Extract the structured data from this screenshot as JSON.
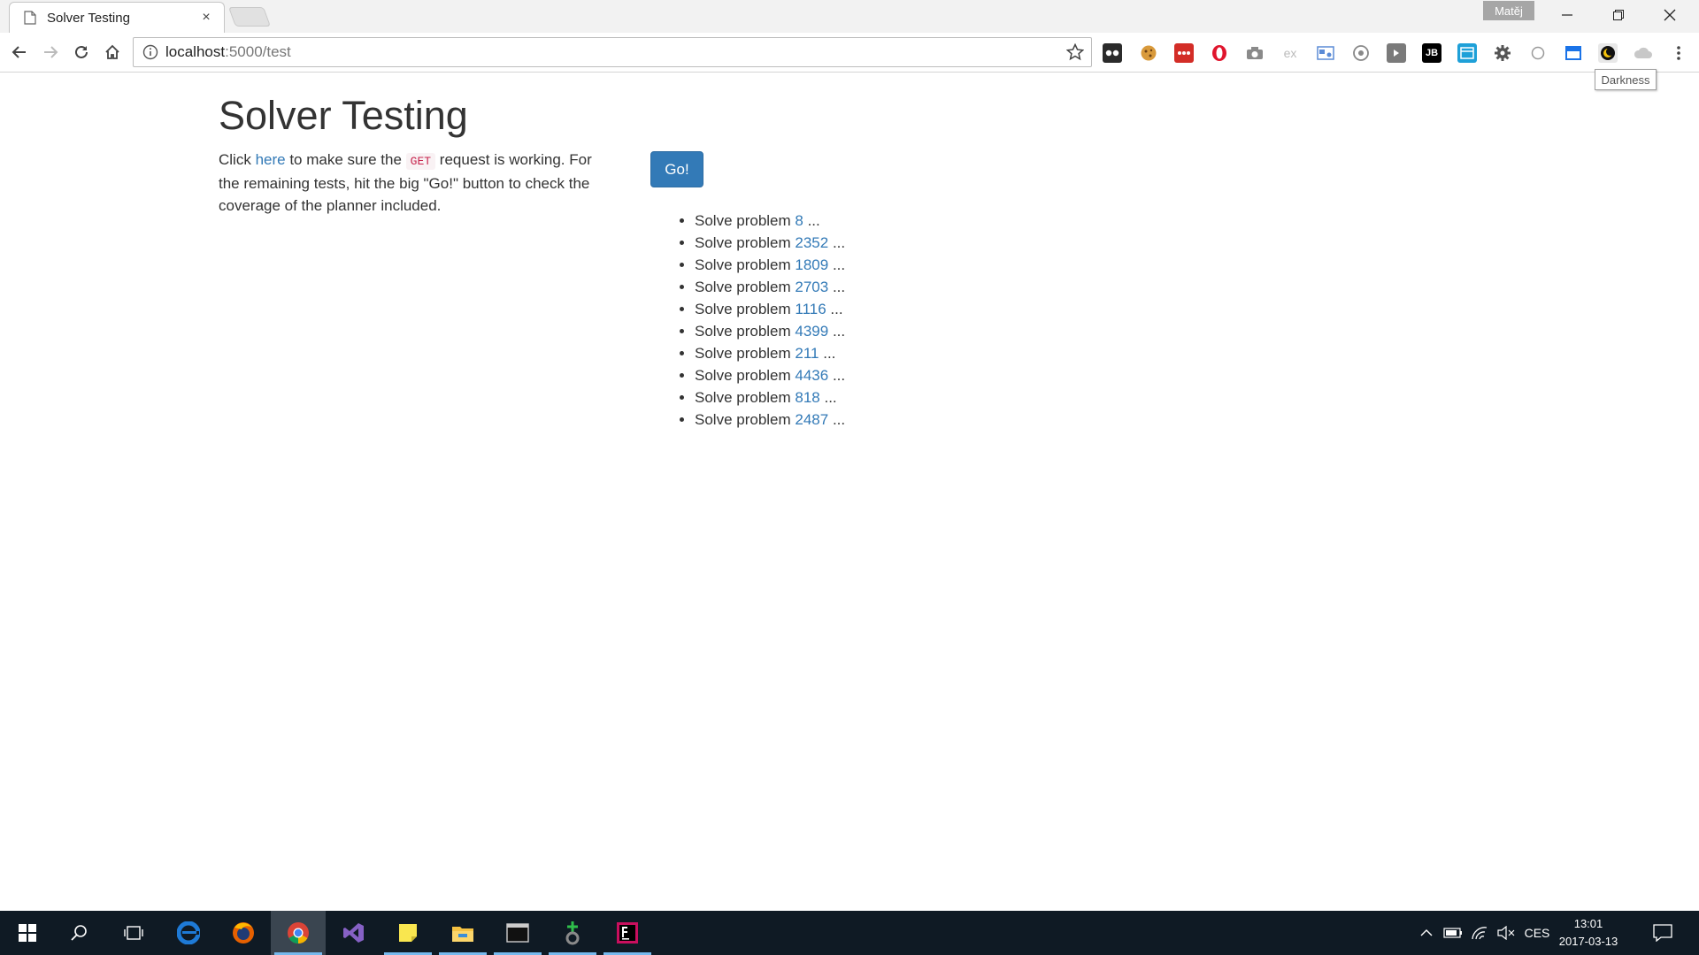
{
  "browser": {
    "tab_title": "Solver Testing",
    "tab_close": "×",
    "profile_name": "Matěj",
    "url_host": "localhost",
    "url_path": ":5000/test",
    "tooltip": "Darkness",
    "extension_icons": [
      "ghostery-icon",
      "cookie-icon",
      "lastpass-icon",
      "opera-icon",
      "camera-icon",
      "ex-icon",
      "screenshot-icon",
      "chrome-extension-icon",
      "arrow-extension-icon",
      "jetbrains-icon",
      "window-extension-icon",
      "settings-extension-icon",
      "circle-extension-icon",
      "calendar-extension-icon",
      "darkness-icon",
      "cloud-extension-icon"
    ],
    "ext_labels": {
      "jb": "JB",
      "ex": "ex"
    }
  },
  "page": {
    "title": "Solver Testing",
    "intro_click": "Click ",
    "intro_link": "here",
    "intro_mid": " to make sure the ",
    "intro_code": "GET",
    "intro_end": " request is working. For the remaining tests, hit the big \"Go!\" button to check the coverage of the planner included.",
    "go_label": "Go!",
    "problem_prefix": "Solve problem ",
    "problem_suffix": " ...",
    "problems": [
      "8",
      "2352",
      "1809",
      "2703",
      "1116",
      "4399",
      "211",
      "4436",
      "818",
      "2487"
    ]
  },
  "taskbar": {
    "apps": [
      "start-icon",
      "search-icon",
      "task-view-icon",
      "edge-icon",
      "firefox-icon",
      "chrome-icon",
      "visual-studio-icon",
      "sticky-notes-icon",
      "file-explorer-icon",
      "terminal-icon",
      "git-icon",
      "rider-icon"
    ],
    "language": "CES",
    "time": "13:01",
    "date": "2017-03-13"
  },
  "colors": {
    "link": "#337ab7",
    "button": "#337ab7",
    "taskbar": "#0f1a24"
  }
}
